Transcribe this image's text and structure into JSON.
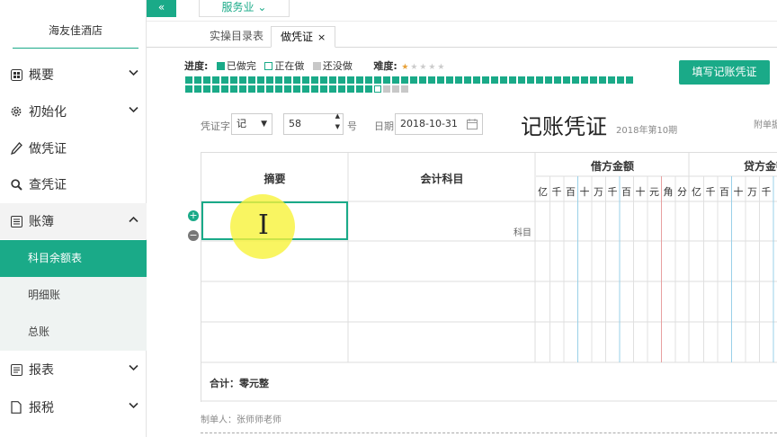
{
  "sidebar": {
    "company": "海友佳酒店",
    "items": [
      {
        "label": "概要",
        "icon": "dashboard-icon"
      },
      {
        "label": "初始化",
        "icon": "gear-icon"
      },
      {
        "label": "做凭证",
        "icon": "pen-icon"
      },
      {
        "label": "查凭证",
        "icon": "search-icon"
      },
      {
        "label": "账簿",
        "icon": "book-icon"
      },
      {
        "label": "报表",
        "icon": "report-icon"
      },
      {
        "label": "报税",
        "icon": "file-icon"
      }
    ],
    "ledger_sub": [
      "科目余额表",
      "明细账",
      "总账"
    ]
  },
  "topbar": {
    "collapse": "«",
    "industry": "服务业"
  },
  "tabs": {
    "t1": "实操目录表",
    "t2": "做凭证",
    "close": "×"
  },
  "progress": {
    "label": "进度:",
    "done": "已做完",
    "doing": "正在做",
    "todo": "还没做",
    "difficulty": "难度:",
    "difficulty_stars": 1,
    "cells_done": 71,
    "cells_current": 1,
    "cells_todo": 3
  },
  "actions": {
    "fill_voucher": "填写记账凭证"
  },
  "voucher": {
    "word_label": "凭证字",
    "word": "记",
    "number": "58",
    "number_suffix": "号",
    "date_label": "日期",
    "date": "2018-10-31",
    "title": "记账凭证",
    "period": "2018年第10期",
    "attach": "附单据",
    "col_summary": "摘要",
    "col_subject": "会计科目",
    "col_debit": "借方金额",
    "col_credit": "贷方金额",
    "digits": [
      "亿",
      "千",
      "百",
      "十",
      "万",
      "千",
      "百",
      "十",
      "元",
      "角",
      "分"
    ],
    "digits_credit": [
      "亿",
      "千",
      "百",
      "十",
      "万",
      "千"
    ],
    "subject_hint": "科目",
    "total": "合计：零元整",
    "maker": "制单人：张师师老师"
  },
  "colors": {
    "accent": "#1aaa88",
    "highlight": "#f7f23a"
  }
}
